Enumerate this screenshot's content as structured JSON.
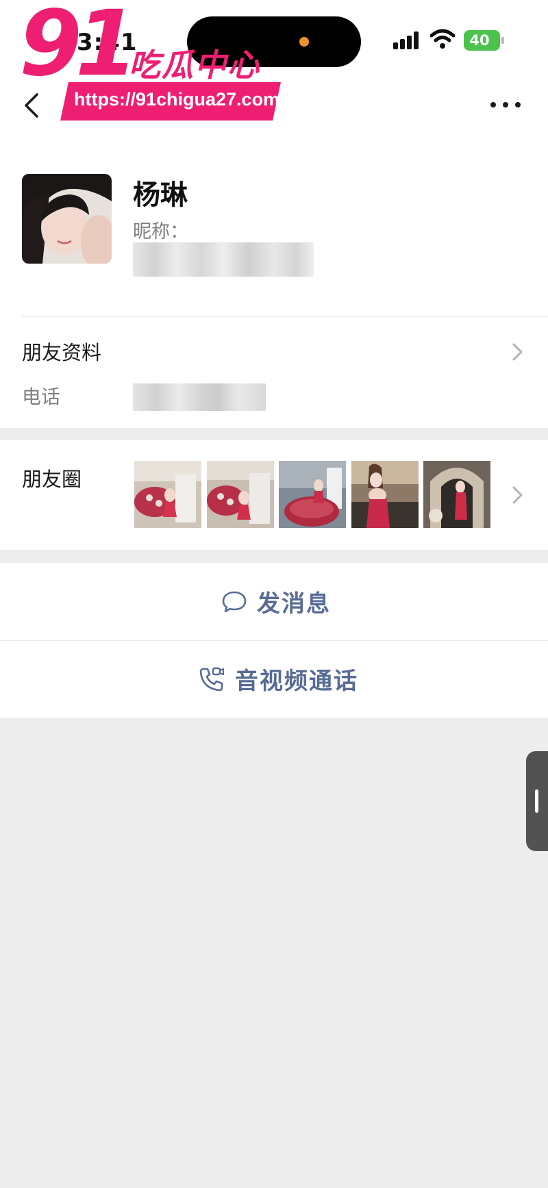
{
  "status_bar": {
    "time": "3:41",
    "battery": "40"
  },
  "watermark": {
    "number": "91",
    "title": "吃瓜中心",
    "url": "https://91chigua27.com"
  },
  "profile": {
    "name": "杨琳",
    "nickname_label": "昵称："
  },
  "friend_info": {
    "title": "朋友资料",
    "phone_label": "电话"
  },
  "moments": {
    "label": "朋友圈",
    "thumbnails": [
      "moments-photo-1",
      "moments-photo-2",
      "moments-photo-3",
      "moments-photo-4",
      "moments-photo-5"
    ]
  },
  "actions": {
    "message": "发消息",
    "call": "音视频通话"
  },
  "colors": {
    "link_blue": "#576b95",
    "watermark_pink": "#ee1f72",
    "battery_green": "#4cc34c",
    "background_gray": "#ededed"
  },
  "icons": [
    "back-arrow-icon",
    "more-icon",
    "chevron-right-icon",
    "chat-bubble-icon",
    "phone-video-icon",
    "signal-icon",
    "wifi-icon",
    "battery-icon"
  ]
}
